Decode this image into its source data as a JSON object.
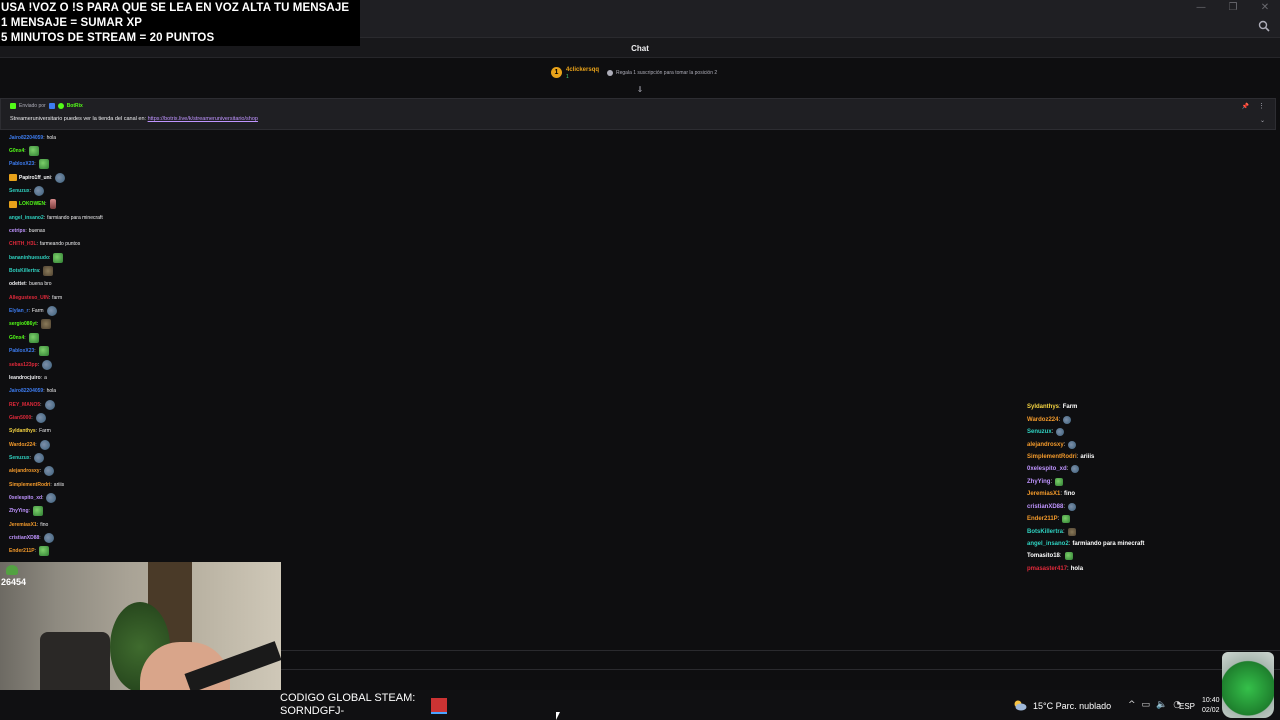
{
  "banner": {
    "line1": "USA !VOZ O !S PARA QUE SE LEA EN VOZ ALTA TU MENSAJE",
    "line2": "1 MENSAJE = SUMAR XP",
    "line3": "5 MINUTOS DE STREAM = 20 PUNTOS"
  },
  "window": {
    "controls": [
      "—",
      "❐",
      "✕"
    ]
  },
  "chat": {
    "title": "Chat",
    "leader": {
      "rank": "1",
      "name": "4clickersqq",
      "count": "1"
    },
    "gift_text": "Regala 1 suscripción para tomar la posición 2",
    "pinned": {
      "sent_by_label": "Enviado por",
      "bot_name": "BotRix",
      "message": "Streameruniversitario puedes ver la tienda del canal en:",
      "link": "https://botrix.live/k/streameruniversitario/shop"
    },
    "messages": [
      {
        "user": "Jairo82204059",
        "color": "#3d7cf0",
        "text": "hola",
        "emote": ""
      },
      {
        "user": "G0nx4",
        "color": "#53fc18",
        "text": "",
        "emote": "frog"
      },
      {
        "user": "PabloxX23",
        "color": "#3d7cf0",
        "text": "",
        "emote": "frog"
      },
      {
        "user": "Papiro1ff_uni",
        "color": "#ffffff",
        "text": "",
        "emote": "peepo",
        "crown": true
      },
      {
        "user": "Senuzux",
        "color": "#2fd1c0",
        "text": "",
        "emote": "peepo"
      },
      {
        "user": "LOKOWEN",
        "color": "#53fc18",
        "text": "",
        "emote": "pink",
        "crown": true
      },
      {
        "user": "angel_insano2",
        "color": "#2fd1c0",
        "text": "farmiando para minecraft",
        "emote": ""
      },
      {
        "user": "cetrips",
        "color": "#bf94ff",
        "text": "buenas",
        "emote": ""
      },
      {
        "user": "CHITH_H3L",
        "color": "#e0293a",
        "text": "farmeando puntos",
        "emote": ""
      },
      {
        "user": "bananinhuesudo",
        "color": "#2fd1c0",
        "text": "",
        "emote": "frog"
      },
      {
        "user": "BotsKillertra",
        "color": "#2fd1c0",
        "text": "",
        "emote": "brown"
      },
      {
        "user": "odettet",
        "color": "#efeff1",
        "text": "buena bro",
        "emote": ""
      },
      {
        "user": "Allegusteso_UIN",
        "color": "#e0293a",
        "text": "farm",
        "emote": ""
      },
      {
        "user": "ElyIan_r",
        "color": "#3d7cf0",
        "text": "Farm",
        "emote": "peepo"
      },
      {
        "user": "sergio086yt",
        "color": "#53fc18",
        "text": "",
        "emote": "brown"
      },
      {
        "user": "G0nx4",
        "color": "#53fc18",
        "text": "",
        "emote": "frog"
      },
      {
        "user": "PabloxX23",
        "color": "#3d7cf0",
        "text": "",
        "emote": "frog"
      },
      {
        "user": "sebas123pp",
        "color": "#e0293a",
        "text": "",
        "emote": "peepo"
      },
      {
        "user": "leandrocjuiro",
        "color": "#efeff1",
        "text": "a",
        "emote": ""
      },
      {
        "user": "Jairo82204059",
        "color": "#3d7cf0",
        "text": "hola",
        "emote": ""
      },
      {
        "user": "REY_MANO5",
        "color": "#e0293a",
        "text": "",
        "emote": "peepo"
      },
      {
        "user": "Gian5000",
        "color": "#e0293a",
        "text": "",
        "emote": "peepo"
      },
      {
        "user": "Syldanthys",
        "color": "#f5d442",
        "text": "Farm",
        "emote": ""
      },
      {
        "user": "Wardoz224",
        "color": "#f39a2b",
        "text": "",
        "emote": "peepo"
      },
      {
        "user": "Senuzux",
        "color": "#2fd1c0",
        "text": "",
        "emote": "peepo"
      },
      {
        "user": "alejandrosxy",
        "color": "#f39a2b",
        "text": "",
        "emote": "peepo"
      },
      {
        "user": "SimplementRodri",
        "color": "#f39a2b",
        "text": "ariiis",
        "emote": ""
      },
      {
        "user": "0xelespito_xd",
        "color": "#bf94ff",
        "text": "",
        "emote": "peepo"
      },
      {
        "user": "ZhyYing",
        "color": "#bf94ff",
        "text": "",
        "emote": "frog"
      },
      {
        "user": "JeremiasX1",
        "color": "#f39a2b",
        "text": "fino",
        "emote": ""
      },
      {
        "user": "cristianXD88",
        "color": "#bf94ff",
        "text": "",
        "emote": "peepo"
      },
      {
        "user": "Ender211P",
        "color": "#f39a2b",
        "text": "",
        "emote": "frog"
      }
    ]
  },
  "overlay_chat": [
    {
      "user": "Syldanthys",
      "color": "#f5d442",
      "text": "Farm",
      "emote": ""
    },
    {
      "user": "Wardoz224",
      "color": "#f39a2b",
      "text": "",
      "emote": "peepo"
    },
    {
      "user": "Senuzux",
      "color": "#2fd1c0",
      "text": "",
      "emote": "peepo"
    },
    {
      "user": "alejandrosxy",
      "color": "#f39a2b",
      "text": "",
      "emote": "peepo"
    },
    {
      "user": "SimplementRodri",
      "color": "#f39a2b",
      "text": "ariiis",
      "emote": ""
    },
    {
      "user": "0xelespito_xd",
      "color": "#bf94ff",
      "text": "",
      "emote": "peepo"
    },
    {
      "user": "ZhyYing",
      "color": "#bf94ff",
      "text": "",
      "emote": "frog"
    },
    {
      "user": "JeremiasX1",
      "color": "#f39a2b",
      "text": "fino",
      "emote": ""
    },
    {
      "user": "cristianXD88",
      "color": "#bf94ff",
      "text": "",
      "emote": "peepo"
    },
    {
      "user": "Ender211P",
      "color": "#f39a2b",
      "text": "",
      "emote": "frog"
    },
    {
      "user": "BotsKillertra",
      "color": "#2fd1c0",
      "text": "",
      "emote": "brown"
    },
    {
      "user": "angel_insano2",
      "color": "#2fd1c0",
      "text": "farmiando para minecraft",
      "emote": ""
    },
    {
      "user": "Tomasito18",
      "color": "#ffffff",
      "text": "",
      "emote": "frog"
    },
    {
      "user": "pmasaster417",
      "color": "#e0293a",
      "text": "hola",
      "emote": ""
    }
  ],
  "stream": {
    "viewers": "26454"
  },
  "steam_code": {
    "line1": "CODIGO GLOBAL STEAM:",
    "line2": "SORNDGFJ-"
  },
  "taskbar": {
    "weather": "15°C  Parc. nublado",
    "lang": "ESP",
    "time": "10:40",
    "date": "02/02",
    "tray_icons": [
      "chevron-up-icon",
      "network-icon",
      "volume-icon",
      "wifi-icon"
    ]
  }
}
